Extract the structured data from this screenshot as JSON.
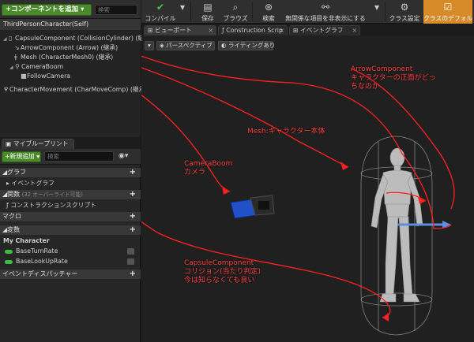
{
  "components": {
    "add_button": "+コンポーネントを追加 ▾",
    "search_placeholder": "検索",
    "root": "ThirdPersonCharacter(Self)",
    "nodes": [
      "CapsuleComponent (CollisionCylinder) (継承",
      "ArrowComponent (Arrow) (継承)",
      "Mesh (CharacterMesh0) (継承)",
      "CameraBoom",
      "FollowCamera",
      "CharacterMovement (CharMoveComp) (継承"
    ]
  },
  "my_blueprint": {
    "tab_label": "マイブループリント",
    "new_button": "+新規追加 ▾",
    "search_placeholder": "検索",
    "sections": {
      "graph": "グラフ",
      "event_graph": "イベントグラフ",
      "functions": "関数",
      "functions_sub": "(32 オーバーライド可能)",
      "construction": "コンストラクションスクリプト",
      "macros": "マクロ",
      "variables": "変数",
      "category": "My Character",
      "var1": "BaseTurnRate",
      "var2": "BaseLookUpRate",
      "dispatchers": "イベントディスパッチャー"
    }
  },
  "toolbar": {
    "compile": "コンパイル",
    "save": "保存",
    "browse": "ブラウズ",
    "search": "検索",
    "hide_unrelated": "無関係な項目を非表示にする",
    "class_settings": "クラス設定",
    "class_defaults": "クラスのデフォルト"
  },
  "tabs": {
    "viewport": "ビューポート",
    "construction": "Construction Scrip",
    "event_graph": "イベントグラフ"
  },
  "viewport": {
    "perspective": "パースペクティブ",
    "lighting": "ライティングあり"
  },
  "annotations": {
    "arrow_title": "ArrowComponent",
    "arrow_desc1": "キャラクターの正面がどっ",
    "arrow_desc2": "ちなのか",
    "mesh": "Mesh:キャラクター本体",
    "camera_title": "CameraBoom",
    "camera_desc": "カメラ",
    "capsule_title": "CapsuleComponent",
    "capsule_desc1": "コリジョン(当たり判定)",
    "capsule_desc2": "今は知らなくても良い"
  },
  "colors": {
    "accent_green": "#4a8a2a",
    "active_orange": "#d68a2a",
    "annotation_red": "#ff2020",
    "direction_arrow": "#5a8fe0"
  }
}
